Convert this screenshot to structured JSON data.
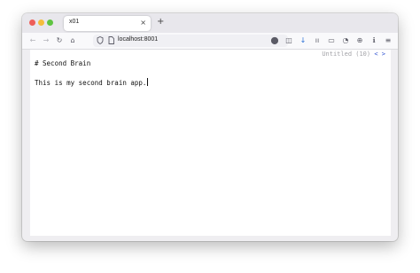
{
  "browser": {
    "tab": {
      "title": "x01",
      "close_icon": "×"
    },
    "new_tab_icon": "+",
    "url": "localhost:8001",
    "nav_icons": {
      "back": "←",
      "forward": "→",
      "reload": "↻",
      "home": "⌂"
    },
    "toolbar_icons": [
      "☆",
      "⬤",
      "◫",
      "↓",
      "ıı",
      "▭",
      "◔",
      "⊕",
      "ℹ",
      "≡"
    ]
  },
  "editor": {
    "status": {
      "name": "Untitled (10)",
      "prev": "<",
      "next": ">"
    },
    "lines": [
      "# Second Brain",
      "",
      "This is my second brain app."
    ]
  }
}
